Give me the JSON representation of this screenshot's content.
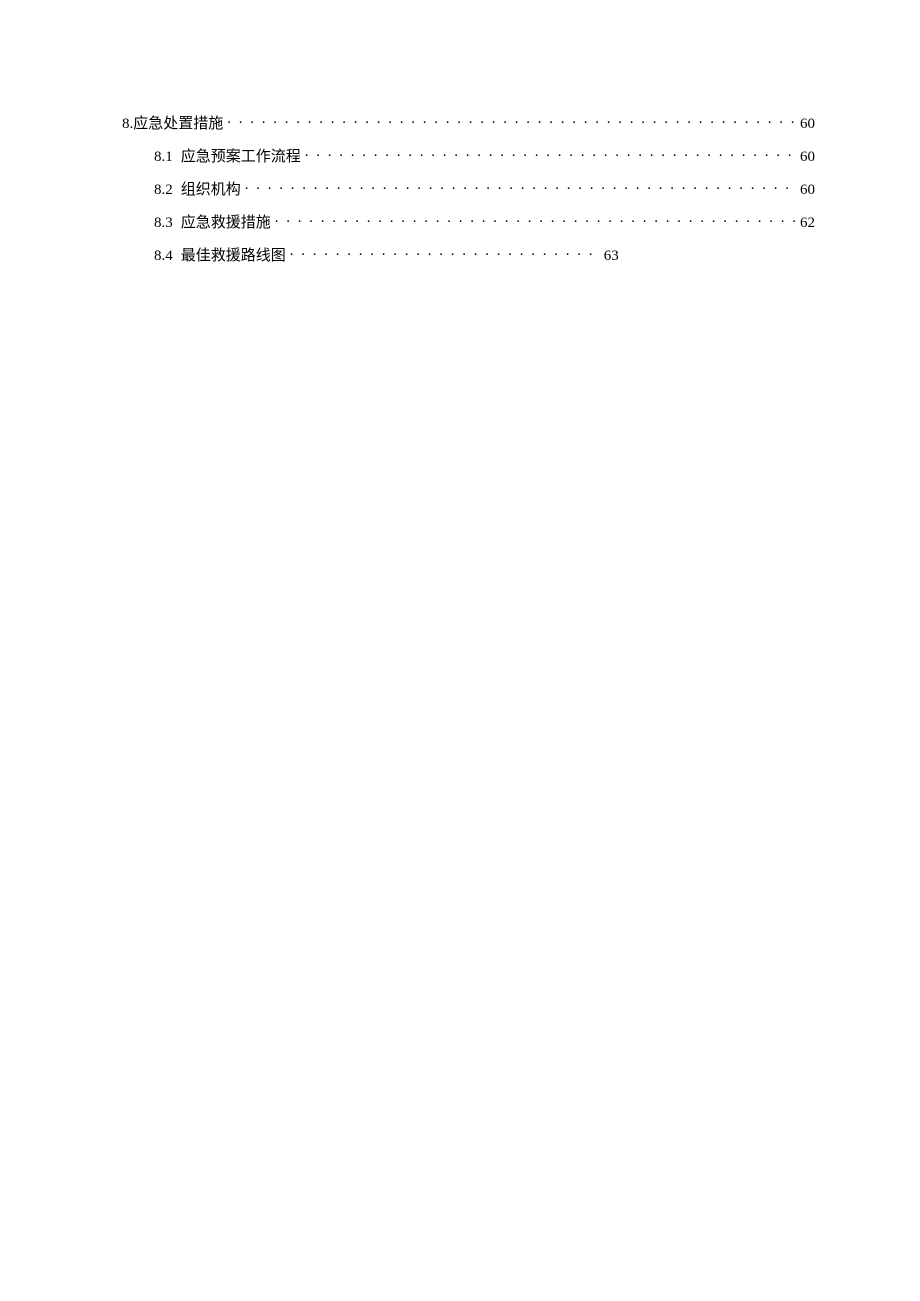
{
  "toc": {
    "section": {
      "number": "8.",
      "title": "应急处置措施",
      "page": "60"
    },
    "subsections": [
      {
        "number": "8.1",
        "title": "应急预案工作流程",
        "page": "60",
        "full_dots": true
      },
      {
        "number": "8.2",
        "title": "组织机构",
        "page": "60",
        "full_dots": true
      },
      {
        "number": "8.3",
        "title": "应急救援措施",
        "page": "62",
        "full_dots": true
      },
      {
        "number": "8.4",
        "title": "最佳救援路线图",
        "page": "63",
        "full_dots": false
      }
    ]
  }
}
